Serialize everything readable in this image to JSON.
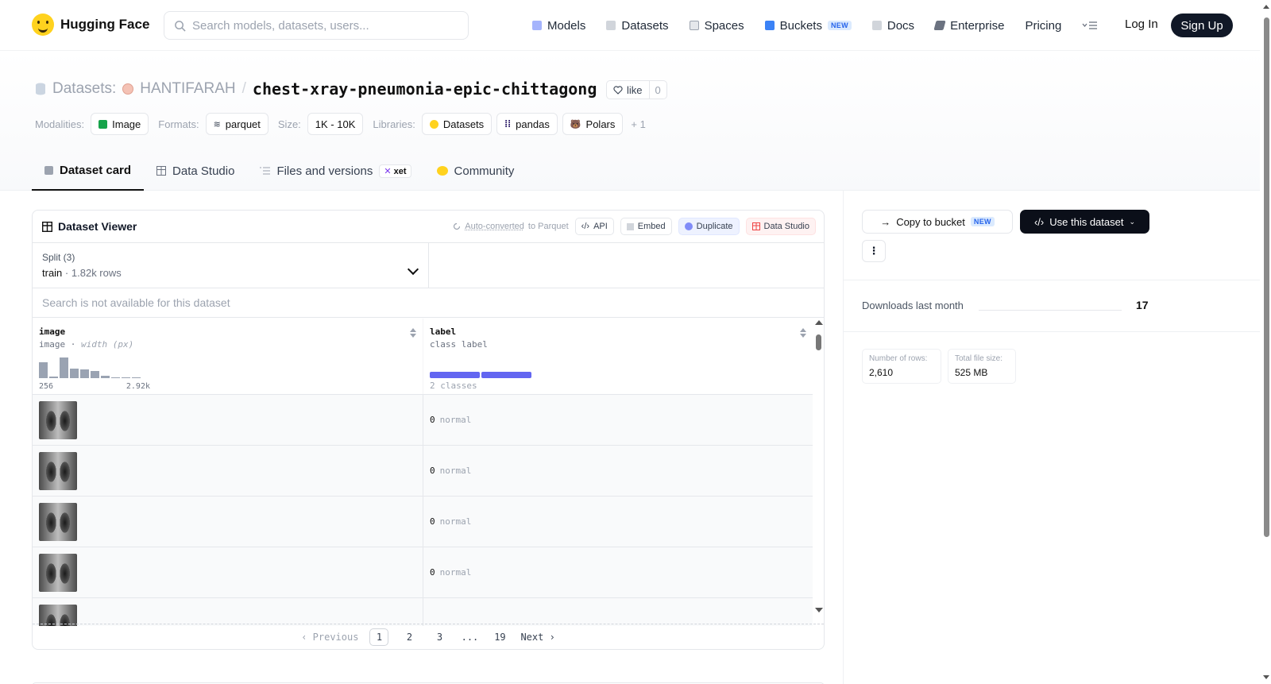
{
  "nav": {
    "brand": "Hugging Face",
    "search_placeholder": "Search models, datasets, users...",
    "links": [
      "Models",
      "Datasets",
      "Spaces",
      "Buckets",
      "Docs",
      "Enterprise",
      "Pricing"
    ],
    "new_tag": "NEW",
    "login": "Log In",
    "signup": "Sign Up"
  },
  "header": {
    "crumb_label": "Datasets:",
    "user": "HANTIFARAH",
    "sep": "/",
    "repo": "chest-xray-pneumonia-epic-chittagong",
    "like_label": "like",
    "like_count": "0",
    "modalities_label": "Modalities:",
    "modality": "Image",
    "formats_label": "Formats:",
    "format": "parquet",
    "size_label": "Size:",
    "size": "1K - 10K",
    "libraries_label": "Libraries:",
    "libraries": [
      "Datasets",
      "pandas",
      "Polars"
    ],
    "libraries_more": "+ 1"
  },
  "tabs": [
    "Dataset card",
    "Data Studio",
    "Files and versions",
    "Community"
  ],
  "xet": "xet",
  "viewer": {
    "title": "Dataset Viewer",
    "auto_link": "Auto-converted",
    "auto_rest": "to Parquet",
    "btn_api": "API",
    "btn_embed": "Embed",
    "btn_duplicate": "Duplicate",
    "btn_studio": "Data Studio",
    "split_title": "Split (3)",
    "split_name": "train",
    "split_dot": "·",
    "split_rows": "1.82k rows",
    "search_na": "Search is not available for this dataset",
    "col1_name": "image",
    "col1_type": "image",
    "col1_sep": "·",
    "col1_sub": "width (px)",
    "hist_min": "256",
    "hist_max": "2.92k",
    "hist_values": [
      18,
      2,
      24,
      11,
      10,
      8,
      3,
      1,
      1,
      1
    ],
    "col2_name": "label",
    "col2_type": "class label",
    "col2_classes": "2 classes",
    "rows": [
      {
        "id": "0",
        "name": "normal"
      },
      {
        "id": "0",
        "name": "normal"
      },
      {
        "id": "0",
        "name": "normal"
      },
      {
        "id": "0",
        "name": "normal"
      }
    ],
    "pager": {
      "prev": "Previous",
      "pages": [
        "1",
        "2",
        "3",
        "...",
        "19"
      ],
      "next": "Next"
    }
  },
  "side": {
    "copy": "Copy to bucket",
    "new_tag": "NEW",
    "use": "Use this dataset",
    "more": "⋮",
    "dl_label": "Downloads last month",
    "dl_val": "17",
    "rows_label": "Number of rows:",
    "rows_val": "2,610",
    "size_label": "Total file size:",
    "size_val": "525 MB"
  },
  "colors": {
    "accent": "#6366f1",
    "brand": "#FFD21E",
    "dark": "#0b0f19"
  }
}
